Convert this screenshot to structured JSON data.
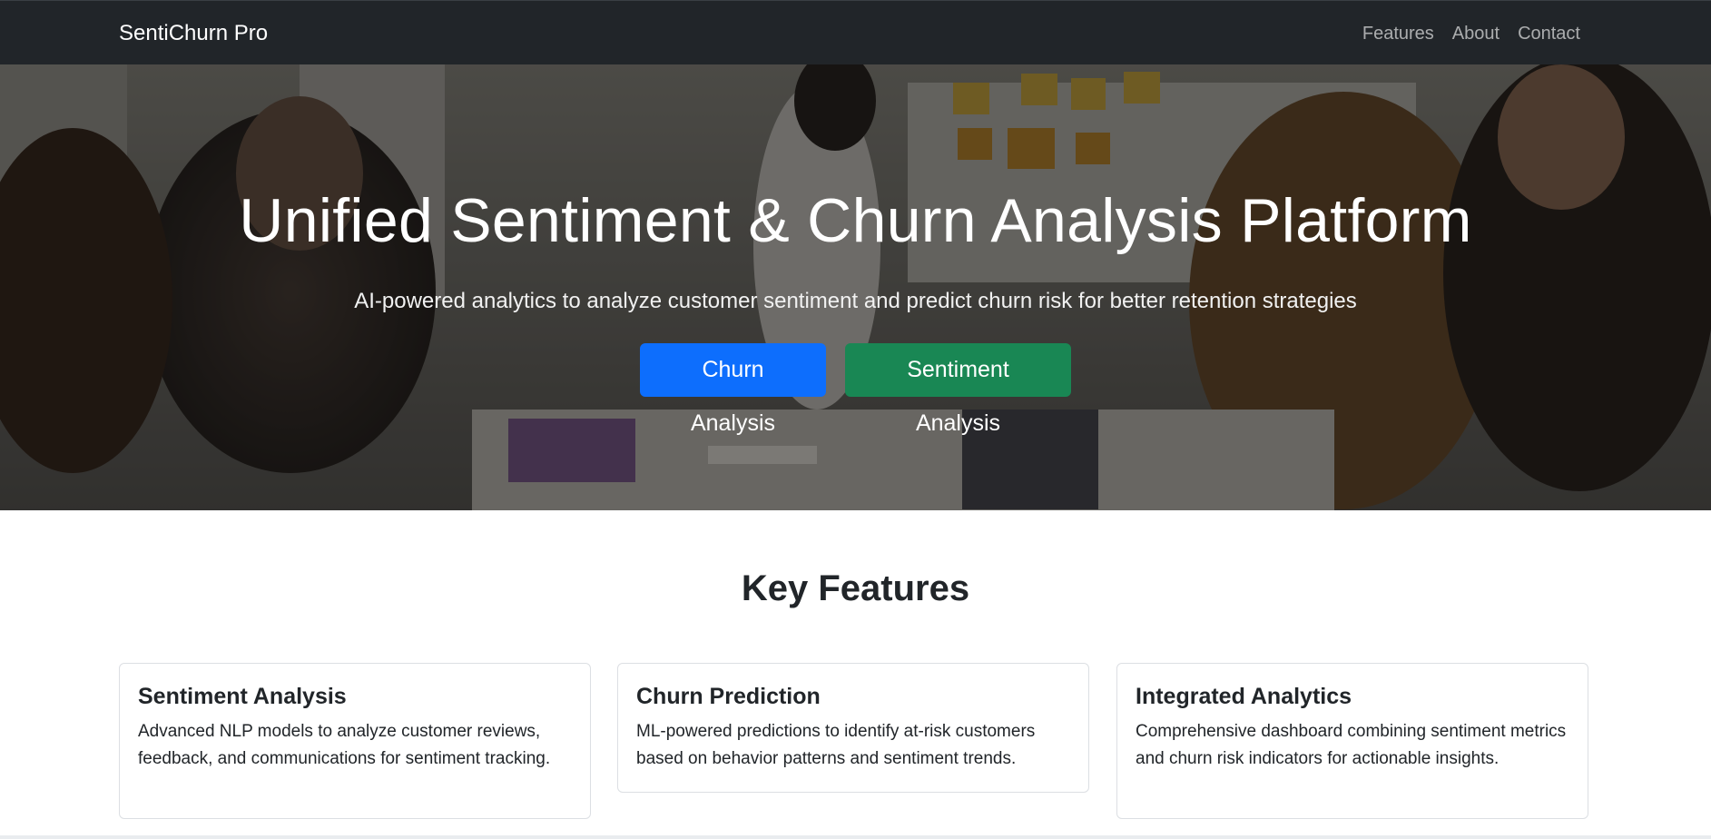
{
  "navbar": {
    "brand": "SentiChurn Pro",
    "links": [
      "Features",
      "About",
      "Contact"
    ]
  },
  "hero": {
    "title": "Unified Sentiment & Churn Analysis Platform",
    "subtitle": "AI-powered analytics to analyze customer sentiment and predict churn risk for better retention strategies",
    "buttons": [
      {
        "label": "Churn Analysis",
        "color": "#0d6efd"
      },
      {
        "label": "Sentiment Analysis",
        "color": "#198754"
      }
    ]
  },
  "features": {
    "title": "Key Features",
    "cards": [
      {
        "title": "Sentiment Analysis",
        "text": "Advanced NLP models to analyze customer reviews, feedback, and communications for sentiment tracking."
      },
      {
        "title": "Churn Prediction",
        "text": "ML-powered predictions to identify at-risk customers based on behavior patterns and sentiment trends."
      },
      {
        "title": "Integrated Analytics",
        "text": "Comprehensive dashboard combining sentiment metrics and churn risk indicators for actionable insights."
      }
    ]
  },
  "colors": {
    "navbar_bg": "#212529",
    "primary": "#0d6efd",
    "success": "#198754"
  }
}
